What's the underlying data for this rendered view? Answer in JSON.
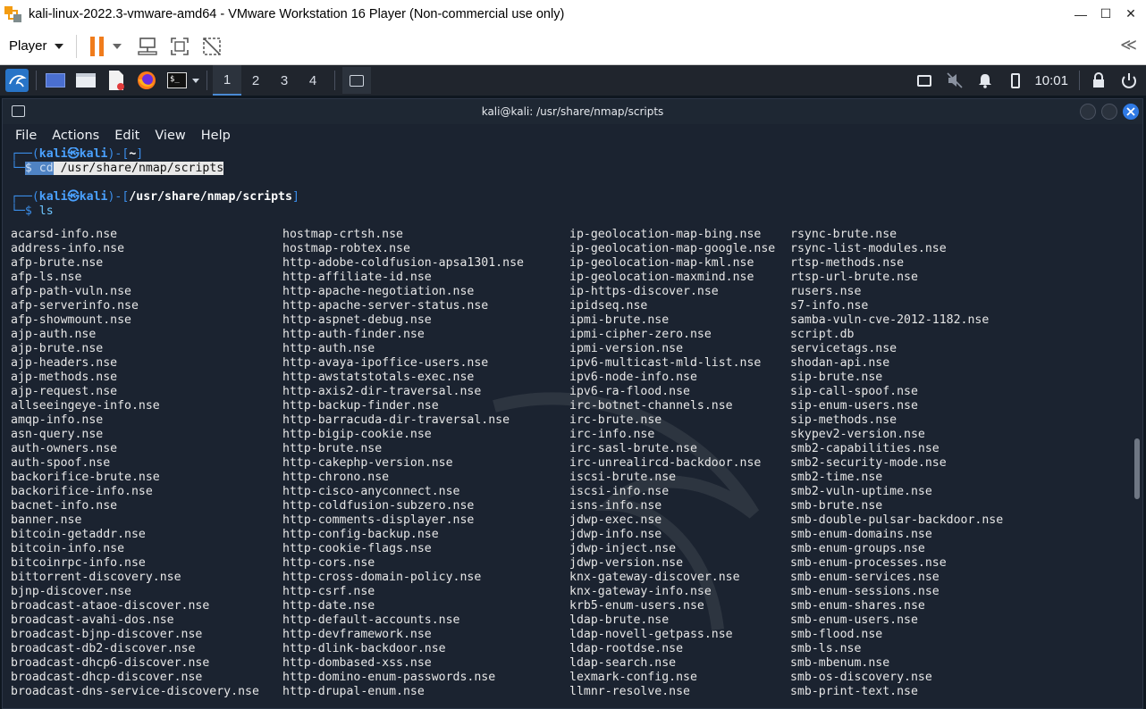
{
  "host_window": {
    "title": "kali-linux-2022.3-vmware-amd64 - VMware Workstation 16 Player (Non-commercial use only)",
    "minimize_label": "—",
    "maximize_label": "☐",
    "close_label": "✕"
  },
  "toolbar": {
    "player_label": "Player",
    "collapse_label": "≪"
  },
  "panel": {
    "workspaces": [
      "1",
      "2",
      "3",
      "4"
    ],
    "active_workspace": "1",
    "clock": "10:01"
  },
  "terminal": {
    "title": "kali@kali: /usr/share/nmap/scripts",
    "menu": [
      "File",
      "Actions",
      "Edit",
      "View",
      "Help"
    ],
    "prompt1": {
      "user": "kali",
      "at": "㉿",
      "host": "kali",
      "dir": "~",
      "command_word": "cd",
      "command_arg": " /usr/share/nmap/scripts"
    },
    "prompt2": {
      "user": "kali",
      "at": "㉿",
      "host": "kali",
      "dir": "/usr/share/nmap/scripts",
      "command": "ls"
    },
    "ls_columns": [
      [
        "acarsd-info.nse",
        "address-info.nse",
        "afp-brute.nse",
        "afp-ls.nse",
        "afp-path-vuln.nse",
        "afp-serverinfo.nse",
        "afp-showmount.nse",
        "ajp-auth.nse",
        "ajp-brute.nse",
        "ajp-headers.nse",
        "ajp-methods.nse",
        "ajp-request.nse",
        "allseeingeye-info.nse",
        "amqp-info.nse",
        "asn-query.nse",
        "auth-owners.nse",
        "auth-spoof.nse",
        "backorifice-brute.nse",
        "backorifice-info.nse",
        "bacnet-info.nse",
        "banner.nse",
        "bitcoin-getaddr.nse",
        "bitcoin-info.nse",
        "bitcoinrpc-info.nse",
        "bittorrent-discovery.nse",
        "bjnp-discover.nse",
        "broadcast-ataoe-discover.nse",
        "broadcast-avahi-dos.nse",
        "broadcast-bjnp-discover.nse",
        "broadcast-db2-discover.nse",
        "broadcast-dhcp6-discover.nse",
        "broadcast-dhcp-discover.nse",
        "broadcast-dns-service-discovery.nse"
      ],
      [
        "hostmap-crtsh.nse",
        "hostmap-robtex.nse",
        "http-adobe-coldfusion-apsa1301.nse",
        "http-affiliate-id.nse",
        "http-apache-negotiation.nse",
        "http-apache-server-status.nse",
        "http-aspnet-debug.nse",
        "http-auth-finder.nse",
        "http-auth.nse",
        "http-avaya-ipoffice-users.nse",
        "http-awstatstotals-exec.nse",
        "http-axis2-dir-traversal.nse",
        "http-backup-finder.nse",
        "http-barracuda-dir-traversal.nse",
        "http-bigip-cookie.nse",
        "http-brute.nse",
        "http-cakephp-version.nse",
        "http-chrono.nse",
        "http-cisco-anyconnect.nse",
        "http-coldfusion-subzero.nse",
        "http-comments-displayer.nse",
        "http-config-backup.nse",
        "http-cookie-flags.nse",
        "http-cors.nse",
        "http-cross-domain-policy.nse",
        "http-csrf.nse",
        "http-date.nse",
        "http-default-accounts.nse",
        "http-devframework.nse",
        "http-dlink-backdoor.nse",
        "http-dombased-xss.nse",
        "http-domino-enum-passwords.nse",
        "http-drupal-enum.nse"
      ],
      [
        "ip-geolocation-map-bing.nse",
        "ip-geolocation-map-google.nse",
        "ip-geolocation-map-kml.nse",
        "ip-geolocation-maxmind.nse",
        "ip-https-discover.nse",
        "ipidseq.nse",
        "ipmi-brute.nse",
        "ipmi-cipher-zero.nse",
        "ipmi-version.nse",
        "ipv6-multicast-mld-list.nse",
        "ipv6-node-info.nse",
        "ipv6-ra-flood.nse",
        "irc-botnet-channels.nse",
        "irc-brute.nse",
        "irc-info.nse",
        "irc-sasl-brute.nse",
        "irc-unrealircd-backdoor.nse",
        "iscsi-brute.nse",
        "iscsi-info.nse",
        "isns-info.nse",
        "jdwp-exec.nse",
        "jdwp-info.nse",
        "jdwp-inject.nse",
        "jdwp-version.nse",
        "knx-gateway-discover.nse",
        "knx-gateway-info.nse",
        "krb5-enum-users.nse",
        "ldap-brute.nse",
        "ldap-novell-getpass.nse",
        "ldap-rootdse.nse",
        "ldap-search.nse",
        "lexmark-config.nse",
        "llmnr-resolve.nse"
      ],
      [
        "rsync-brute.nse",
        "rsync-list-modules.nse",
        "rtsp-methods.nse",
        "rtsp-url-brute.nse",
        "rusers.nse",
        "s7-info.nse",
        "samba-vuln-cve-2012-1182.nse",
        "script.db",
        "servicetags.nse",
        "shodan-api.nse",
        "sip-brute.nse",
        "sip-call-spoof.nse",
        "sip-enum-users.nse",
        "sip-methods.nse",
        "skypev2-version.nse",
        "smb2-capabilities.nse",
        "smb2-security-mode.nse",
        "smb2-time.nse",
        "smb2-vuln-uptime.nse",
        "smb-brute.nse",
        "smb-double-pulsar-backdoor.nse",
        "smb-enum-domains.nse",
        "smb-enum-groups.nse",
        "smb-enum-processes.nse",
        "smb-enum-services.nse",
        "smb-enum-sessions.nse",
        "smb-enum-shares.nse",
        "smb-enum-users.nse",
        "smb-flood.nse",
        "smb-ls.nse",
        "smb-mbenum.nse",
        "smb-os-discovery.nse",
        "smb-print-text.nse"
      ]
    ]
  },
  "colors": {
    "prompt_bracket": "#3b8eea",
    "prompt_user": "#4aa1ff",
    "terminal_bg": "#1b2330",
    "panel_bg": "#20252d"
  }
}
